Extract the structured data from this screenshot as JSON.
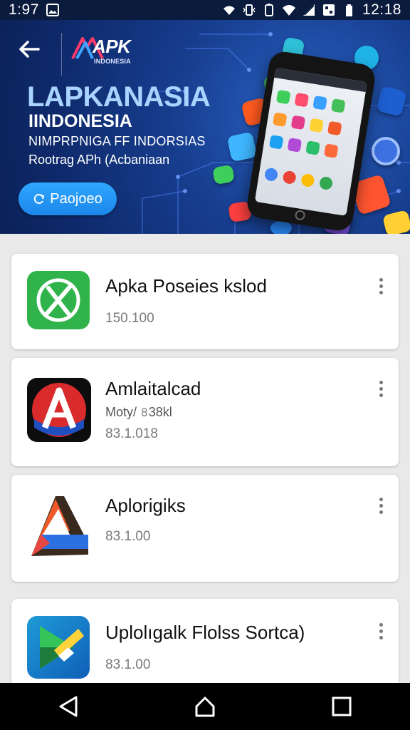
{
  "status_bar": {
    "time_left": "1:97",
    "time_right": "12:18",
    "icons": [
      "gallery-icon",
      "wifi-icon",
      "vibrate-icon",
      "battery-icon",
      "signal-icon",
      "nfc-icon"
    ]
  },
  "banner": {
    "logo_text": "APK",
    "logo_subtext": "INDONESIA",
    "headline_1": "LAPKANASIA",
    "headline_2": "IINDONESIA",
    "headline_3": "NIMPRPNIGA FF INDORSIAS",
    "headline_4": "Rootrag APh (Acbaniaan",
    "cta_label": "Paojoeo",
    "colors": {
      "accent": "#1e90ff",
      "banner_bg": "#173e8f",
      "headline_light": "#a9d4ff"
    }
  },
  "apps": [
    {
      "name": "Apka Poseies kslod",
      "sub": "",
      "price": "150.100",
      "icon": "green-x-app-icon"
    },
    {
      "name": "Amlaitalcad",
      "sub": "Moty/ ৪38kl",
      "price": "83.1.018",
      "icon": "red-a-app-icon"
    },
    {
      "name": "Aplorigiks",
      "sub": "",
      "price": "83.1.00",
      "icon": "orange-a-app-icon"
    },
    {
      "name": "Uplolıgalk Flolss Sortca)",
      "sub": "",
      "price": "83.1.00",
      "icon": "blue-play-app-icon"
    }
  ],
  "nav": {
    "back": "back-icon",
    "home": "home-icon",
    "recents": "recents-icon"
  }
}
